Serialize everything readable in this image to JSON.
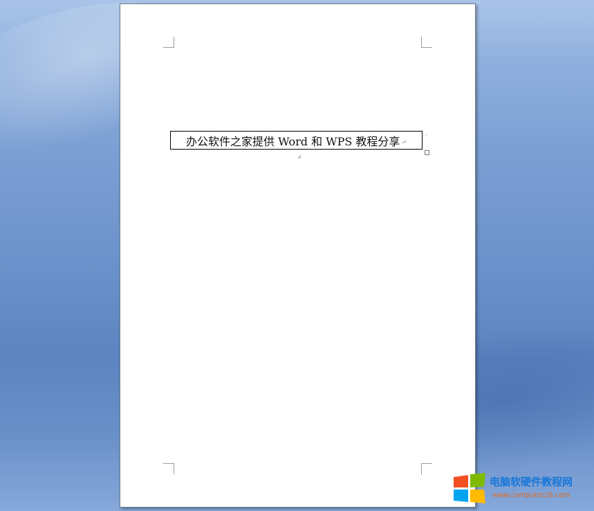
{
  "document": {
    "textbox_text": "办公软件之家提供 Word 和 WPS 教程分享",
    "paragraph_mark": "↲",
    "end_mark": "↵"
  },
  "watermark": {
    "title": "电脑软硬件教程网",
    "url": "www.computer26.com",
    "logo_colors": [
      "#f25022",
      "#7fba00",
      "#00a4ef",
      "#ffb900"
    ]
  },
  "colors": {
    "workspace_bg": "#6d93cc",
    "page_bg": "#ffffff"
  }
}
